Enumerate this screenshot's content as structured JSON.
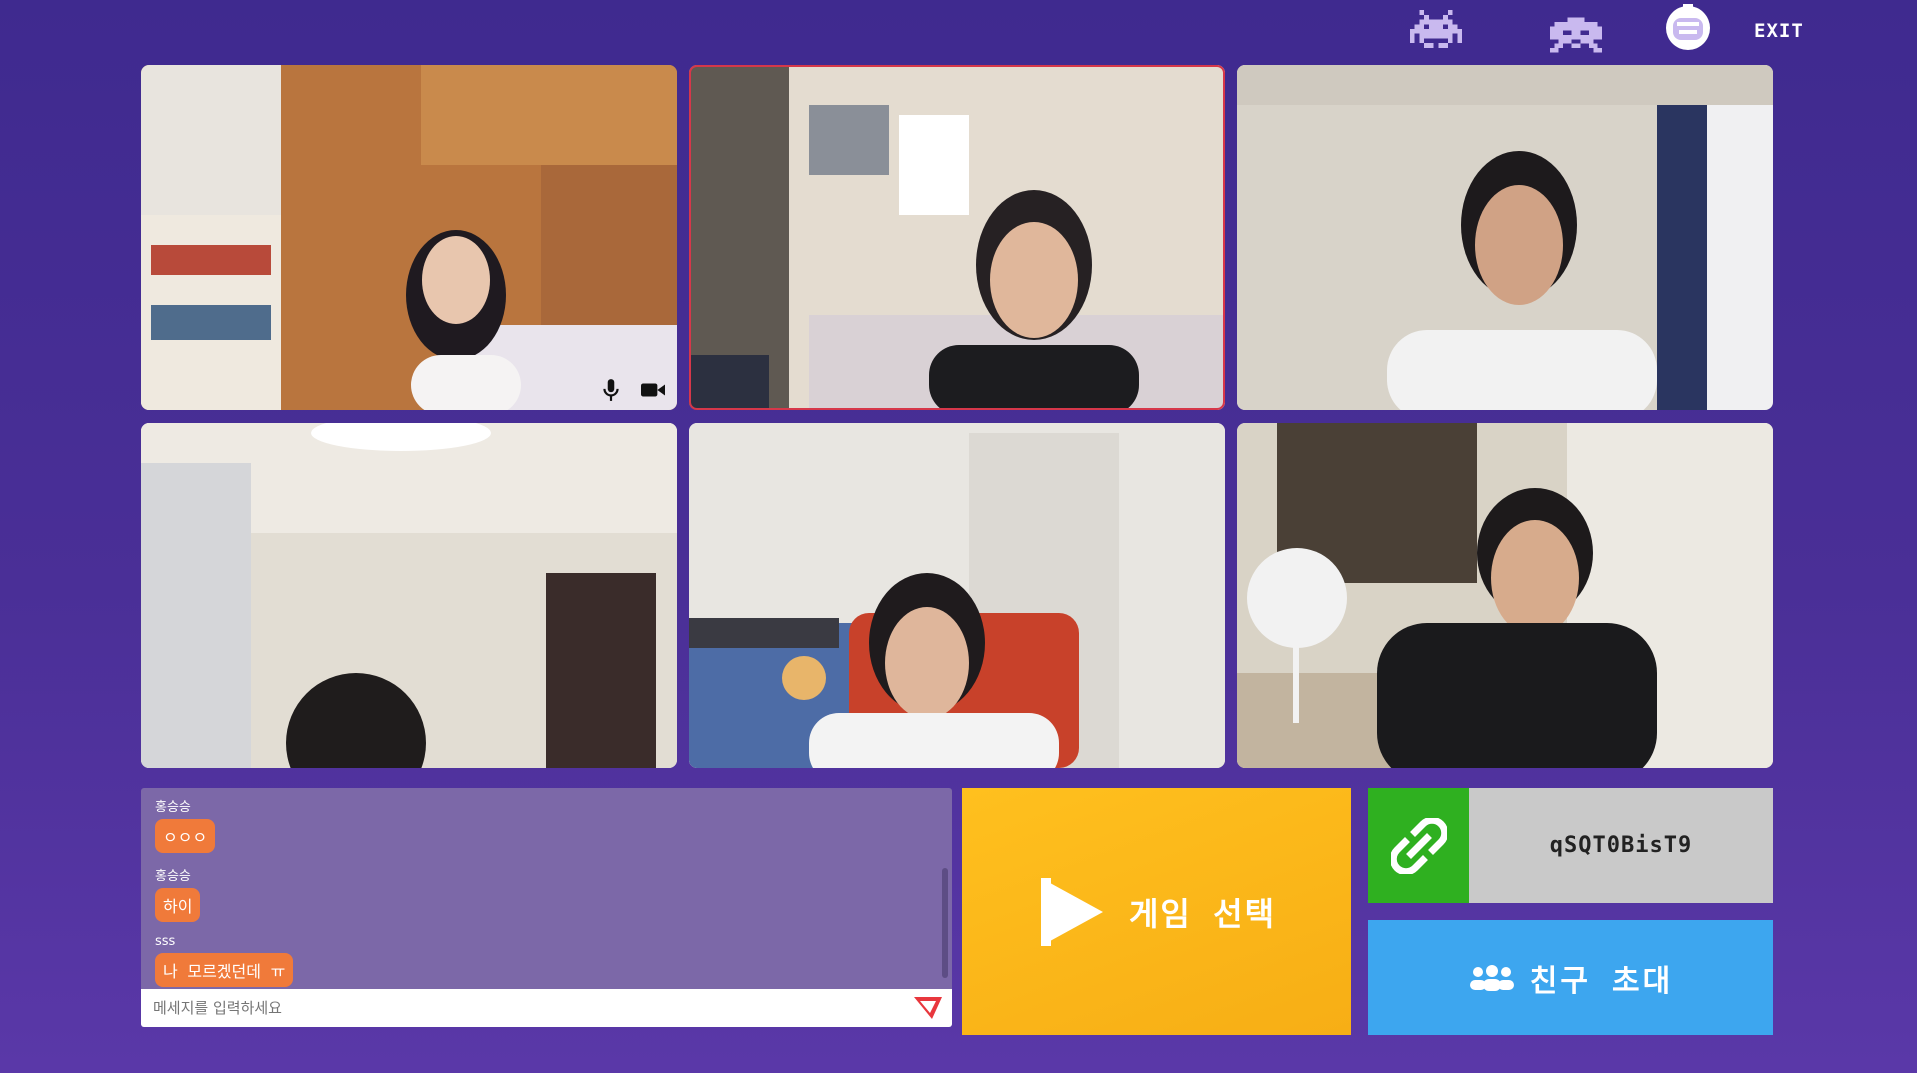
{
  "header": {
    "exit_label": "EXIT",
    "icons": [
      "space-invader-icon",
      "space-invader-icon",
      "astronaut-icon"
    ]
  },
  "participants": [
    {
      "index": 1,
      "active": false,
      "controls": [
        "microphone-icon",
        "camera-icon"
      ]
    },
    {
      "index": 2,
      "active": true
    },
    {
      "index": 3,
      "active": false
    },
    {
      "index": 4,
      "active": false
    },
    {
      "index": 5,
      "active": false
    },
    {
      "index": 6,
      "active": false
    }
  ],
  "chat": {
    "messages": [
      {
        "name": "홍승승",
        "text": "ㅇㅇㅇ"
      },
      {
        "name": "홍승승",
        "text": "하이"
      },
      {
        "name": "sss",
        "text": "나 모르겠던데 ㅠ"
      }
    ],
    "placeholder": "메세지를 입력하세요"
  },
  "game": {
    "label": "게임 선택"
  },
  "room": {
    "code": "qSQT0BisT9"
  },
  "invite": {
    "label": "친구 초대"
  },
  "colors": {
    "background": "#4a2f97",
    "game_button": "#f7ae15",
    "invite_button": "#3da6ef",
    "link_button": "#2fb020",
    "chat_bubble": "#f07a3a",
    "chat_panel": "#7c68a8",
    "active_outline": "#d6374a"
  }
}
